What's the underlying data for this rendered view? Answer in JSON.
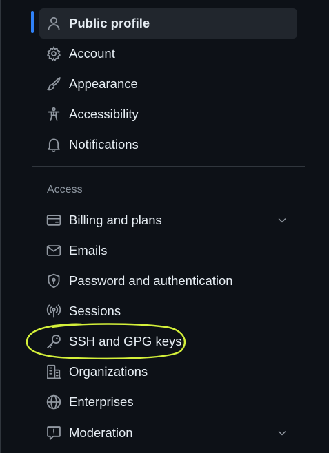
{
  "nav_top": [
    {
      "label": "Public profile",
      "icon": "person-icon",
      "active": true
    },
    {
      "label": "Account",
      "icon": "gear-icon"
    },
    {
      "label": "Appearance",
      "icon": "paintbrush-icon"
    },
    {
      "label": "Accessibility",
      "icon": "accessibility-icon"
    },
    {
      "label": "Notifications",
      "icon": "bell-icon"
    }
  ],
  "access_section": {
    "heading": "Access",
    "items": [
      {
        "label": "Billing and plans",
        "icon": "credit-card-icon",
        "expandable": true
      },
      {
        "label": "Emails",
        "icon": "mail-icon"
      },
      {
        "label": "Password and authentication",
        "icon": "shield-lock-icon"
      },
      {
        "label": "Sessions",
        "icon": "broadcast-icon"
      },
      {
        "label": "SSH and GPG keys",
        "icon": "key-icon",
        "highlighted": true
      },
      {
        "label": "Organizations",
        "icon": "organization-icon"
      },
      {
        "label": "Enterprises",
        "icon": "globe-icon"
      },
      {
        "label": "Moderation",
        "icon": "report-icon",
        "expandable": true
      }
    ]
  },
  "colors": {
    "background": "#0d1117",
    "text": "#e6edf3",
    "muted": "#8d96a0",
    "active_bg": "#21262d",
    "accent": "#2f81f7",
    "annotation": "#d4f03a"
  }
}
